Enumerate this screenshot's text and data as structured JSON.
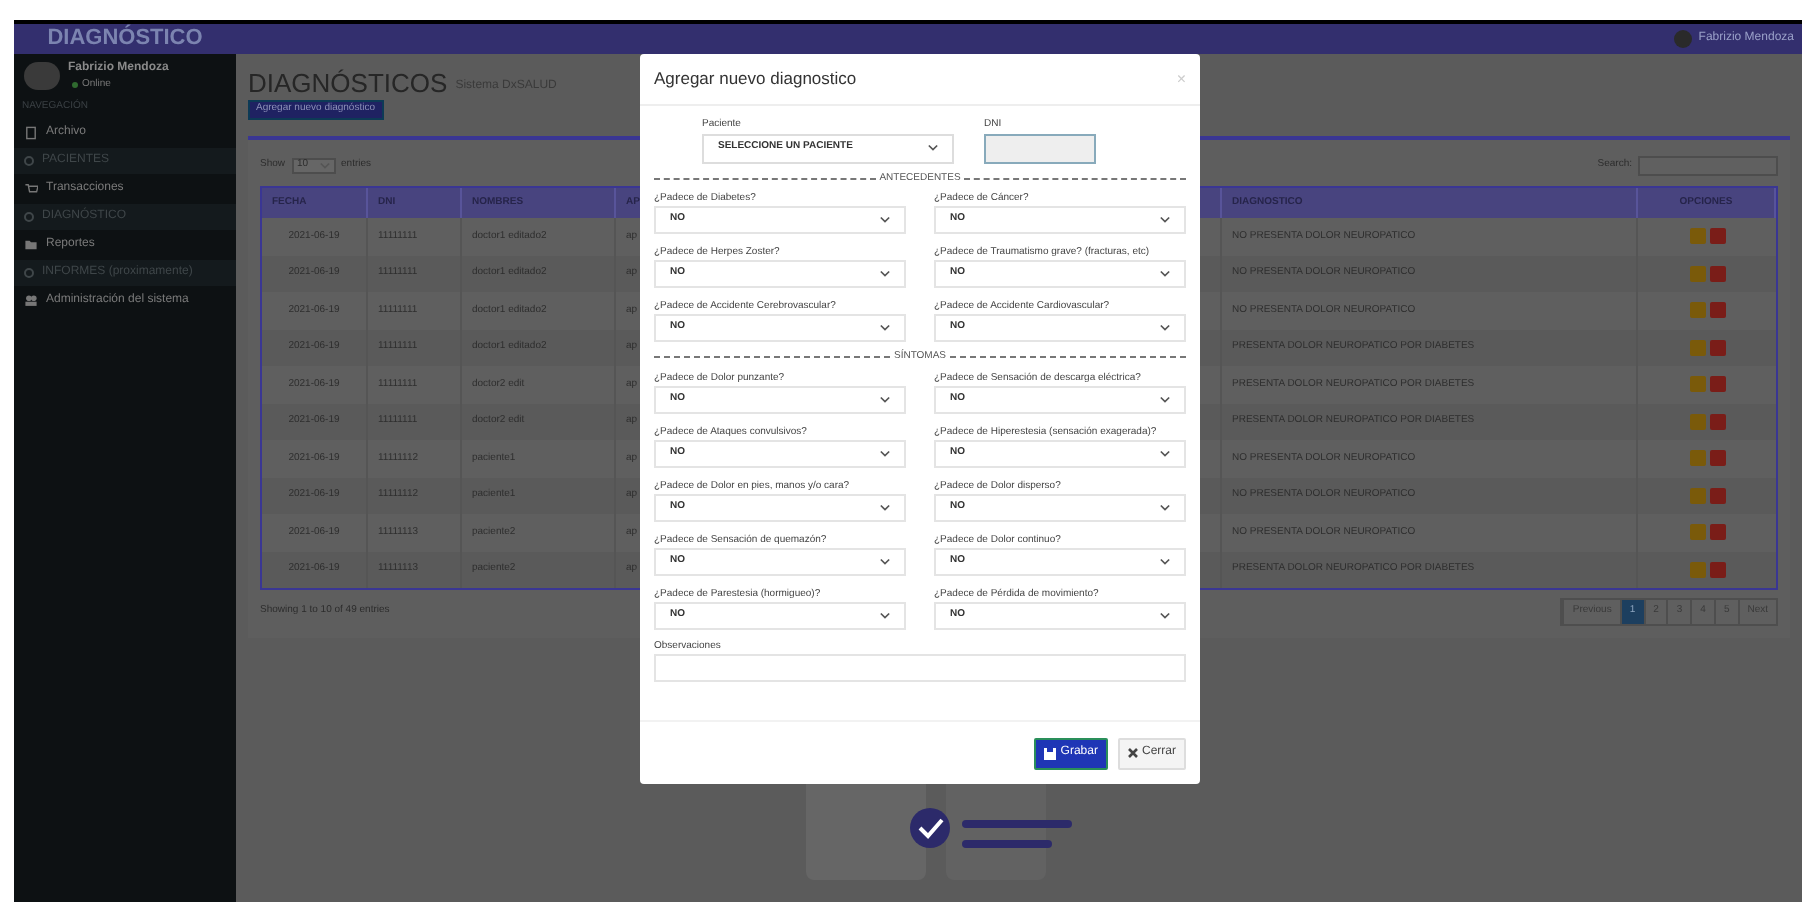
{
  "sidebar": {
    "brand": "DIAGNÓSTICO",
    "user": {
      "name": "Fabrizio Mendoza",
      "status": "Online"
    },
    "section": "NAVEGACIÓN",
    "items": [
      {
        "label": "Archivo",
        "kind": "group"
      },
      {
        "label": "PACIENTES",
        "kind": "sub"
      },
      {
        "label": "Transacciones",
        "kind": "group"
      },
      {
        "label": "DIAGNÓSTICO",
        "kind": "sub"
      },
      {
        "label": "Reportes",
        "kind": "group"
      },
      {
        "label": "INFORMES (proximamente)",
        "kind": "sub"
      },
      {
        "label": "Administración del sistema",
        "kind": "group"
      }
    ]
  },
  "header": {
    "user": "Fabrizio Mendoza"
  },
  "page": {
    "title": "DIAGNÓSTICOS",
    "subtitle": "Sistema DxSALUD",
    "add_button": "Agregar nuevo diagnóstico"
  },
  "table": {
    "show_label": "Show",
    "page_size": "10",
    "entries_label": "entries",
    "search_label": "Search:",
    "columns": [
      "FECHA",
      "DNI",
      "NOMBRES",
      "AP",
      "DIAGNOSTICO",
      "OPCIONES"
    ],
    "rows": [
      [
        "2021-06-19",
        "11111111",
        "doctor1 editado2",
        "ap",
        "NO PRESENTA DOLOR NEUROPATICO"
      ],
      [
        "2021-06-19",
        "11111111",
        "doctor1 editado2",
        "ap",
        "NO PRESENTA DOLOR NEUROPATICO"
      ],
      [
        "2021-06-19",
        "11111111",
        "doctor1 editado2",
        "ap",
        "NO PRESENTA DOLOR NEUROPATICO"
      ],
      [
        "2021-06-19",
        "11111111",
        "doctor1 editado2",
        "ap",
        "PRESENTA DOLOR NEUROPATICO POR DIABETES"
      ],
      [
        "2021-06-19",
        "11111111",
        "doctor2 edit",
        "ap",
        "PRESENTA DOLOR NEUROPATICO POR DIABETES"
      ],
      [
        "2021-06-19",
        "11111111",
        "doctor2 edit",
        "ap",
        "PRESENTA DOLOR NEUROPATICO POR DIABETES"
      ],
      [
        "2021-06-19",
        "11111112",
        "paciente1",
        "ap",
        "NO PRESENTA DOLOR NEUROPATICO"
      ],
      [
        "2021-06-19",
        "11111112",
        "paciente1",
        "ap",
        "NO PRESENTA DOLOR NEUROPATICO"
      ],
      [
        "2021-06-19",
        "11111113",
        "paciente2",
        "ap",
        "NO PRESENTA DOLOR NEUROPATICO"
      ],
      [
        "2021-06-19",
        "11111113",
        "paciente2",
        "ap",
        "PRESENTA DOLOR NEUROPATICO POR DIABETES"
      ]
    ],
    "info": "Showing 1 to 10 of 49 entries",
    "pagination": [
      {
        "label": "Previous",
        "selected": false
      },
      {
        "label": "1",
        "selected": true
      },
      {
        "label": "2",
        "selected": false
      },
      {
        "label": "3",
        "selected": false
      },
      {
        "label": "4",
        "selected": false
      },
      {
        "label": "5",
        "selected": false
      },
      {
        "label": "Next",
        "selected": false
      }
    ]
  },
  "modal": {
    "title": "Agregar nuevo diagnostico",
    "close": "×",
    "patient_label": "Paciente",
    "patient_value": "SELECCIONE UN PACIENTE",
    "dni_label": "DNI",
    "sections": [
      {
        "title": "ANTECEDENTES",
        "questions": [
          {
            "label": "¿Padece de Diabetes?",
            "value": "NO"
          },
          {
            "label": "¿Padece de Cáncer?",
            "value": "NO"
          },
          {
            "label": "¿Padece de Herpes Zoster?",
            "value": "NO"
          },
          {
            "label": "¿Padece de Traumatismo grave? (fracturas, etc)",
            "value": "NO"
          },
          {
            "label": "¿Padece de Accidente Cerebrovascular?",
            "value": "NO"
          },
          {
            "label": "¿Padece de Accidente Cardiovascular?",
            "value": "NO"
          }
        ]
      },
      {
        "title": "SÍNTOMAS",
        "questions": [
          {
            "label": "¿Padece de Dolor punzante?",
            "value": "NO"
          },
          {
            "label": "¿Padece de Sensación de descarga eléctrica?",
            "value": "NO"
          },
          {
            "label": "¿Padece de Ataques convulsivos?",
            "value": "NO"
          },
          {
            "label": "¿Padece de Hiperestesia (sensación exagerada)?",
            "value": "NO"
          },
          {
            "label": "¿Padece de Dolor en pies, manos y/o cara?",
            "value": "NO"
          },
          {
            "label": "¿Padece de Dolor disperso?",
            "value": "NO"
          },
          {
            "label": "¿Padece de Sensación de quemazón?",
            "value": "NO"
          },
          {
            "label": "¿Padece de Dolor continuo?",
            "value": "NO"
          },
          {
            "label": "¿Padece de Parestesia (hormigueo)?",
            "value": "NO"
          },
          {
            "label": "¿Padece de Pérdida de movimiento?",
            "value": "NO"
          }
        ]
      }
    ],
    "notes_label": "Observaciones",
    "save": "Grabar",
    "cancel": "Cerrar"
  }
}
